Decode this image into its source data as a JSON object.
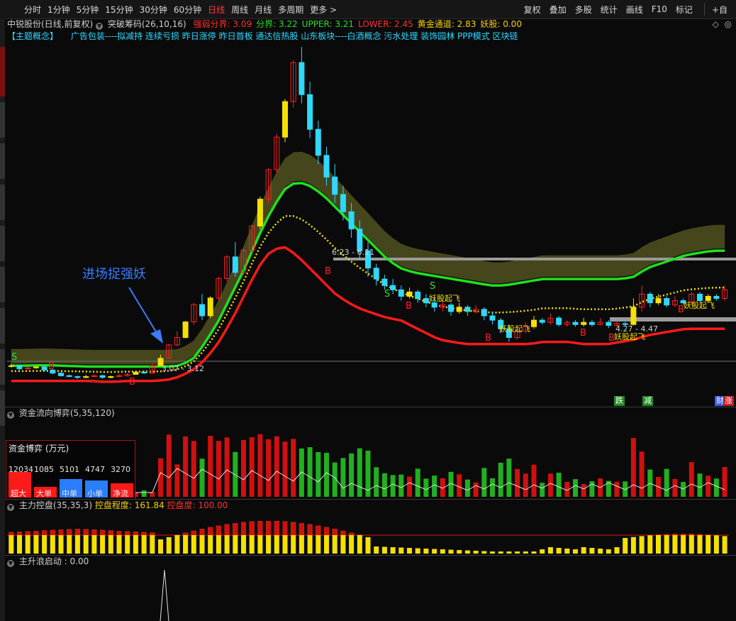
{
  "toolbar": {
    "left_items": [
      "分时",
      "1分钟",
      "5分钟",
      "15分钟",
      "30分钟",
      "60分钟",
      "日线",
      "周线",
      "月线",
      "多周期",
      "更多 >"
    ],
    "active": "日线",
    "right_items": [
      "复权",
      "叠加",
      "多股",
      "统计",
      "画线",
      "F10",
      "标记",
      "+自"
    ]
  },
  "main_panel": {
    "stock_label": "中锐股份(日线,前复权)",
    "indicator_name": "突破筹码(26,10,16)",
    "values": [
      {
        "label": "强弱分界",
        "value": "3.09",
        "color": "#ff3030"
      },
      {
        "label": "分界",
        "value": "3.22",
        "color": "#20e020"
      },
      {
        "label": "UPPER",
        "value": "3.21",
        "color": "#20e020"
      },
      {
        "label": "LOWER",
        "value": "2.45",
        "color": "#ff3030"
      },
      {
        "label": "黄金通道",
        "value": "2.83",
        "color": "#f5d000"
      },
      {
        "label": "妖股",
        "value": "0.00",
        "color": "#f5d000"
      }
    ],
    "concept_tag": "【主题概念】",
    "concepts": "广告包装----拟减持 连续亏损 昨日涨停 昨日首板 通达信热股 山东板块----白酒概念 污水处理 装饰园林 PPP模式 区块链",
    "annotation": "进场捉强妖",
    "range_labels": [
      "3.07 - 3.12",
      "6.23 - 6.11",
      "4.27 - 4.47"
    ],
    "signal_labels": [
      "妖股起飞",
      "妖股起飞",
      "妖股起飞",
      "妖股起飞"
    ],
    "b_label": "B",
    "s_label": "S",
    "flags": [
      "跌",
      "减",
      "财",
      "涨"
    ]
  },
  "panel2": {
    "title": "资金流向博弈(5,35,120)",
    "box_title": "资金博弈 (万元)",
    "bars": [
      {
        "label": "超大",
        "value": "12034",
        "color": "#ff1a1a",
        "ratio": 0.62
      },
      {
        "label": "大单",
        "value": "1085",
        "color": "#ff1a1a",
        "ratio": 0.25
      },
      {
        "label": "中单",
        "value": "5101",
        "color": "#2a7dff",
        "ratio": 0.45
      },
      {
        "label": "小单",
        "value": "4747",
        "color": "#2a7dff",
        "ratio": 0.42
      },
      {
        "label": "净流",
        "value": "3270",
        "color": "#ff1a1a",
        "ratio": 0.35
      }
    ]
  },
  "panel3": {
    "title": "主力控盘(35,35,3)",
    "v1_label": "控盘程度",
    "v1_value": "161.84",
    "v2_label": "控盘度",
    "v2_value": "100.00"
  },
  "panel4": {
    "title": "主升浪启动",
    "value": "0.00"
  },
  "chart_data": {
    "type": "candlestick",
    "description_series": {
      "green_channel_upper": [
        2.95,
        2.95,
        2.96,
        2.96,
        2.95,
        2.94,
        2.93,
        2.93,
        2.93,
        2.93,
        2.93,
        2.93,
        2.93,
        2.95,
        3.1,
        3.5,
        4.0,
        4.6,
        5.2,
        5.9,
        6.5,
        7.0,
        7.2,
        7.1,
        6.9,
        6.6,
        6.3,
        6.0,
        5.7,
        5.4,
        5.2,
        5.1,
        5.05,
        5.0,
        4.95,
        4.9,
        4.85,
        4.8,
        4.8,
        4.85,
        4.9,
        4.95,
        4.95,
        4.95,
        4.95,
        4.95,
        4.95,
        4.95,
        5.0,
        5.2,
        5.3,
        5.4,
        5.5,
        5.55,
        5.6,
        5.6
      ],
      "red_channel_lower": [
        2.6,
        2.6,
        2.6,
        2.6,
        2.6,
        2.6,
        2.6,
        2.58,
        2.58,
        2.6,
        2.6,
        2.6,
        2.62,
        2.7,
        2.85,
        3.1,
        3.5,
        4.0,
        4.6,
        5.2,
        5.6,
        5.7,
        5.5,
        5.2,
        4.9,
        4.6,
        4.4,
        4.25,
        4.15,
        4.05,
        4.0,
        3.85,
        3.7,
        3.55,
        3.5,
        3.45,
        3.45,
        3.45,
        3.45,
        3.45,
        3.45,
        3.5,
        3.5,
        3.5,
        3.45,
        3.45,
        3.45,
        3.5,
        3.55,
        3.65,
        3.7,
        3.75,
        3.8,
        3.8,
        3.8,
        3.8
      ]
    },
    "ylim": [
      2.3,
      10.4
    ],
    "candles": [
      [
        2.95,
        2.95,
        3.0,
        2.9
      ],
      [
        2.95,
        2.88,
        2.98,
        2.85
      ],
      [
        2.88,
        2.9,
        2.93,
        2.85
      ],
      [
        2.9,
        2.92,
        2.95,
        2.88
      ],
      [
        2.92,
        2.85,
        2.94,
        2.82
      ],
      [
        2.85,
        2.78,
        2.87,
        2.75
      ],
      [
        2.78,
        2.72,
        2.8,
        2.7
      ],
      [
        2.72,
        2.7,
        2.75,
        2.68
      ],
      [
        2.7,
        2.68,
        2.72,
        2.65
      ],
      [
        2.68,
        2.7,
        2.74,
        2.66
      ],
      [
        2.7,
        2.72,
        2.75,
        2.68
      ],
      [
        2.72,
        2.68,
        2.74,
        2.65
      ],
      [
        2.68,
        2.7,
        2.72,
        2.66
      ],
      [
        2.7,
        2.72,
        2.76,
        2.68
      ],
      [
        2.72,
        2.75,
        2.78,
        2.7
      ],
      [
        2.75,
        2.8,
        2.84,
        2.74
      ],
      [
        2.8,
        2.78,
        2.84,
        2.76
      ],
      [
        2.78,
        2.95,
        3.0,
        2.77
      ],
      [
        2.95,
        3.12,
        3.2,
        2.94
      ],
      [
        3.12,
        3.43,
        3.45,
        3.1
      ],
      [
        3.43,
        3.6,
        3.75,
        3.4
      ],
      [
        3.6,
        3.96,
        3.98,
        3.58
      ],
      [
        3.96,
        4.36,
        4.4,
        3.9
      ],
      [
        4.36,
        4.1,
        4.6,
        4.0
      ],
      [
        4.1,
        4.51,
        4.55,
        4.05
      ],
      [
        4.51,
        4.96,
        5.0,
        4.45
      ],
      [
        4.96,
        5.46,
        5.5,
        4.9
      ],
      [
        5.46,
        5.1,
        5.8,
        5.0
      ],
      [
        5.1,
        5.61,
        5.65,
        5.05
      ],
      [
        5.61,
        6.17,
        6.2,
        5.55
      ],
      [
        6.17,
        6.79,
        6.85,
        6.1
      ],
      [
        6.79,
        7.47,
        7.5,
        6.7
      ],
      [
        7.47,
        8.22,
        8.3,
        7.4
      ],
      [
        8.22,
        9.04,
        9.1,
        8.1
      ],
      [
        9.04,
        9.94,
        10.0,
        8.9
      ],
      [
        9.94,
        9.2,
        10.3,
        9.0
      ],
      [
        9.2,
        8.4,
        9.5,
        8.2
      ],
      [
        8.4,
        7.8,
        8.6,
        7.6
      ],
      [
        7.8,
        7.3,
        8.0,
        7.1
      ],
      [
        7.3,
        6.9,
        7.6,
        6.7
      ],
      [
        6.9,
        6.5,
        7.1,
        6.3
      ],
      [
        6.5,
        6.1,
        6.7,
        5.9
      ],
      [
        6.1,
        5.6,
        6.3,
        5.4
      ],
      [
        5.6,
        5.2,
        5.8,
        5.0
      ],
      [
        5.2,
        4.95,
        5.3,
        4.8
      ],
      [
        4.95,
        4.8,
        5.05,
        4.7
      ],
      [
        4.8,
        4.7,
        4.95,
        4.6
      ],
      [
        4.7,
        4.55,
        4.8,
        4.45
      ],
      [
        4.55,
        4.65,
        4.75,
        4.5
      ],
      [
        4.65,
        4.5,
        4.7,
        4.4
      ],
      [
        4.5,
        4.4,
        4.6,
        4.3
      ],
      [
        4.4,
        4.3,
        4.5,
        4.2
      ],
      [
        4.3,
        4.35,
        4.45,
        4.2
      ],
      [
        4.35,
        4.2,
        4.4,
        4.1
      ],
      [
        4.2,
        4.3,
        4.4,
        4.15
      ],
      [
        4.3,
        4.2,
        4.35,
        4.1
      ],
      [
        4.2,
        4.25,
        4.35,
        4.15
      ],
      [
        4.25,
        4.1,
        4.3,
        4.0
      ],
      [
        4.1,
        4.0,
        4.2,
        3.9
      ],
      [
        4.0,
        3.8,
        4.05,
        3.7
      ],
      [
        3.8,
        3.6,
        3.9,
        3.5
      ],
      [
        3.6,
        3.75,
        3.8,
        3.55
      ],
      [
        3.75,
        3.85,
        3.95,
        3.7
      ],
      [
        3.85,
        4.0,
        4.1,
        3.8
      ],
      [
        4.0,
        3.95,
        4.05,
        3.9
      ],
      [
        3.95,
        4.05,
        4.15,
        3.9
      ],
      [
        4.05,
        3.9,
        4.1,
        3.85
      ],
      [
        3.9,
        3.95,
        4.0,
        3.85
      ],
      [
        3.95,
        3.9,
        4.0,
        3.85
      ],
      [
        3.9,
        3.95,
        4.05,
        3.85
      ],
      [
        3.95,
        3.9,
        4.0,
        3.85
      ],
      [
        3.9,
        3.95,
        4.05,
        3.88
      ],
      [
        3.95,
        3.88,
        4.0,
        3.82
      ],
      [
        3.88,
        3.92,
        3.98,
        3.85
      ],
      [
        3.92,
        3.9,
        3.96,
        3.86
      ],
      [
        3.9,
        4.3,
        4.5,
        3.88
      ],
      [
        4.3,
        4.6,
        4.8,
        4.2
      ],
      [
        4.6,
        4.4,
        4.65,
        4.3
      ],
      [
        4.4,
        4.5,
        4.6,
        4.35
      ],
      [
        4.5,
        4.35,
        4.55,
        4.3
      ],
      [
        4.35,
        4.45,
        4.55,
        4.3
      ],
      [
        4.45,
        4.4,
        4.5,
        4.35
      ],
      [
        4.4,
        4.6,
        4.65,
        4.35
      ],
      [
        4.6,
        4.45,
        4.65,
        4.4
      ],
      [
        4.45,
        4.55,
        4.6,
        4.4
      ],
      [
        4.55,
        4.5,
        4.6,
        4.45
      ],
      [
        4.5,
        4.7,
        4.8,
        4.45
      ]
    ]
  }
}
